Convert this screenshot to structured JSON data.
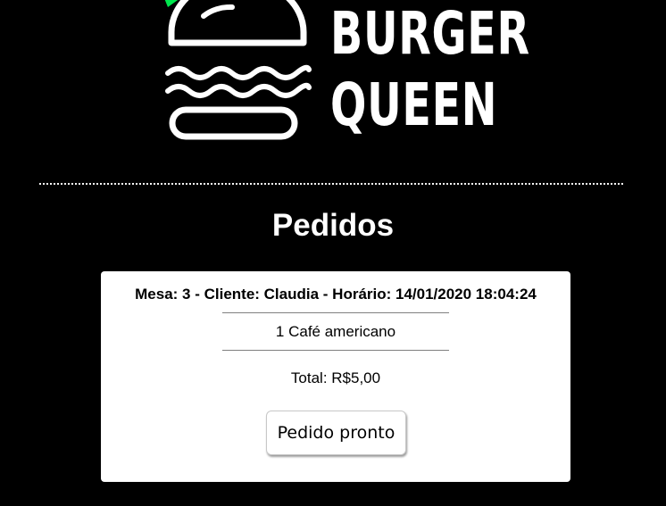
{
  "brand": {
    "line1": "BURGER",
    "line2": "QUEEN",
    "icon": "burger-logo-icon",
    "accent_color": "#00e64d"
  },
  "page": {
    "title": "Pedidos"
  },
  "order": {
    "header": "Mesa: 3 - Cliente: Claudia - Horário: 14/01/2020 18:04:24",
    "items": [
      "1 Café americano"
    ],
    "total": "Total: R$5,00",
    "action_label": "Pedido pronto"
  },
  "colors": {
    "background": "#000000",
    "card": "#ffffff",
    "text": "#000000"
  }
}
